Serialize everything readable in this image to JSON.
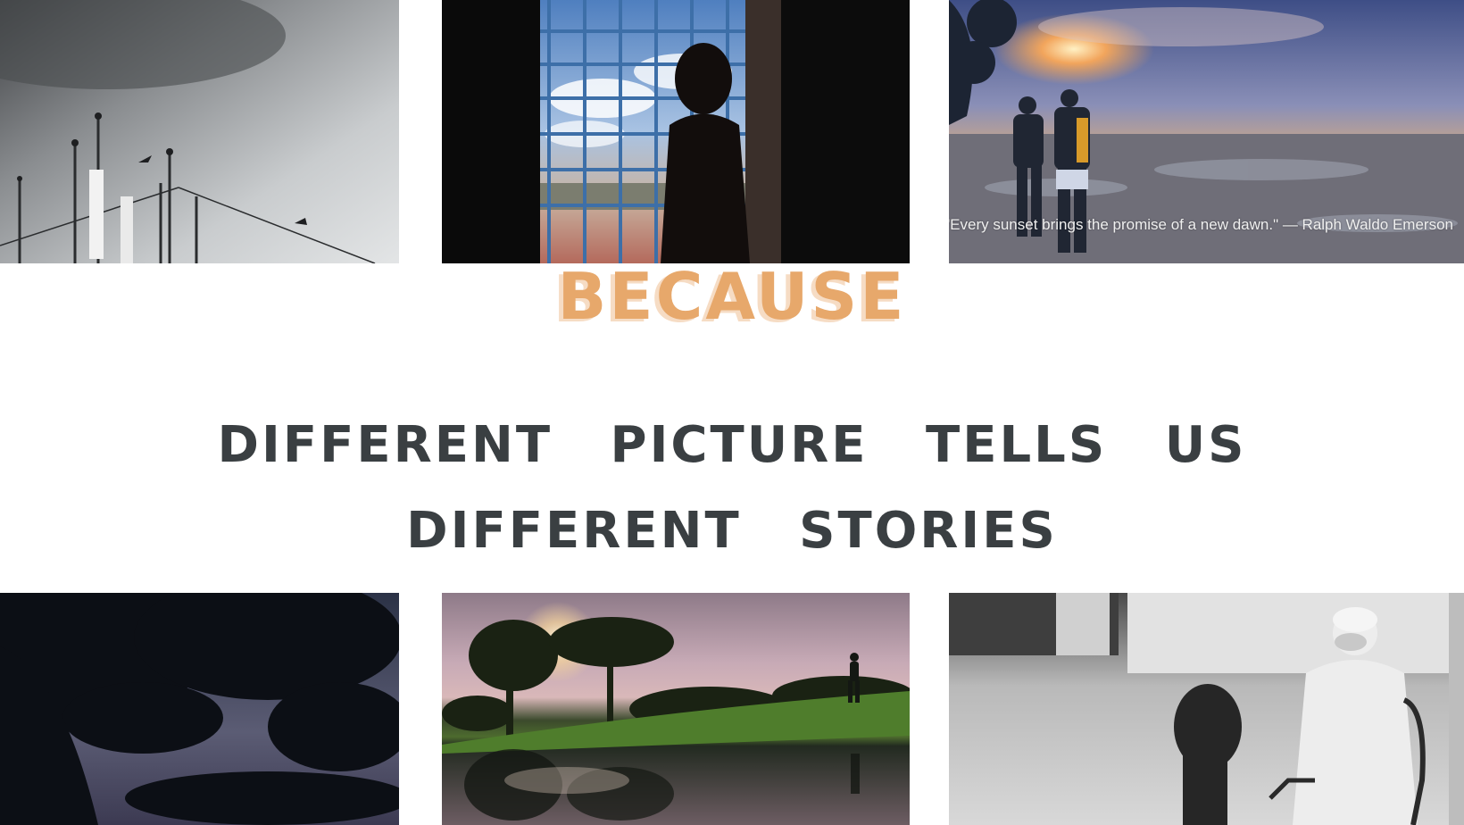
{
  "hero": {
    "word": "BECAUSE",
    "line1": "DIFFERENT PICTURE TELLS US",
    "line2": "DIFFERENT STORIES"
  },
  "photos": {
    "sunset_caption": "\"Every sunset brings the promise of a new dawn.\" — Ralph Waldo Emerson"
  },
  "colors": {
    "accent": "#e7a86b",
    "accent_shadow": "#f6dcc4",
    "headline": "#3a3f42",
    "background": "#ffffff"
  }
}
